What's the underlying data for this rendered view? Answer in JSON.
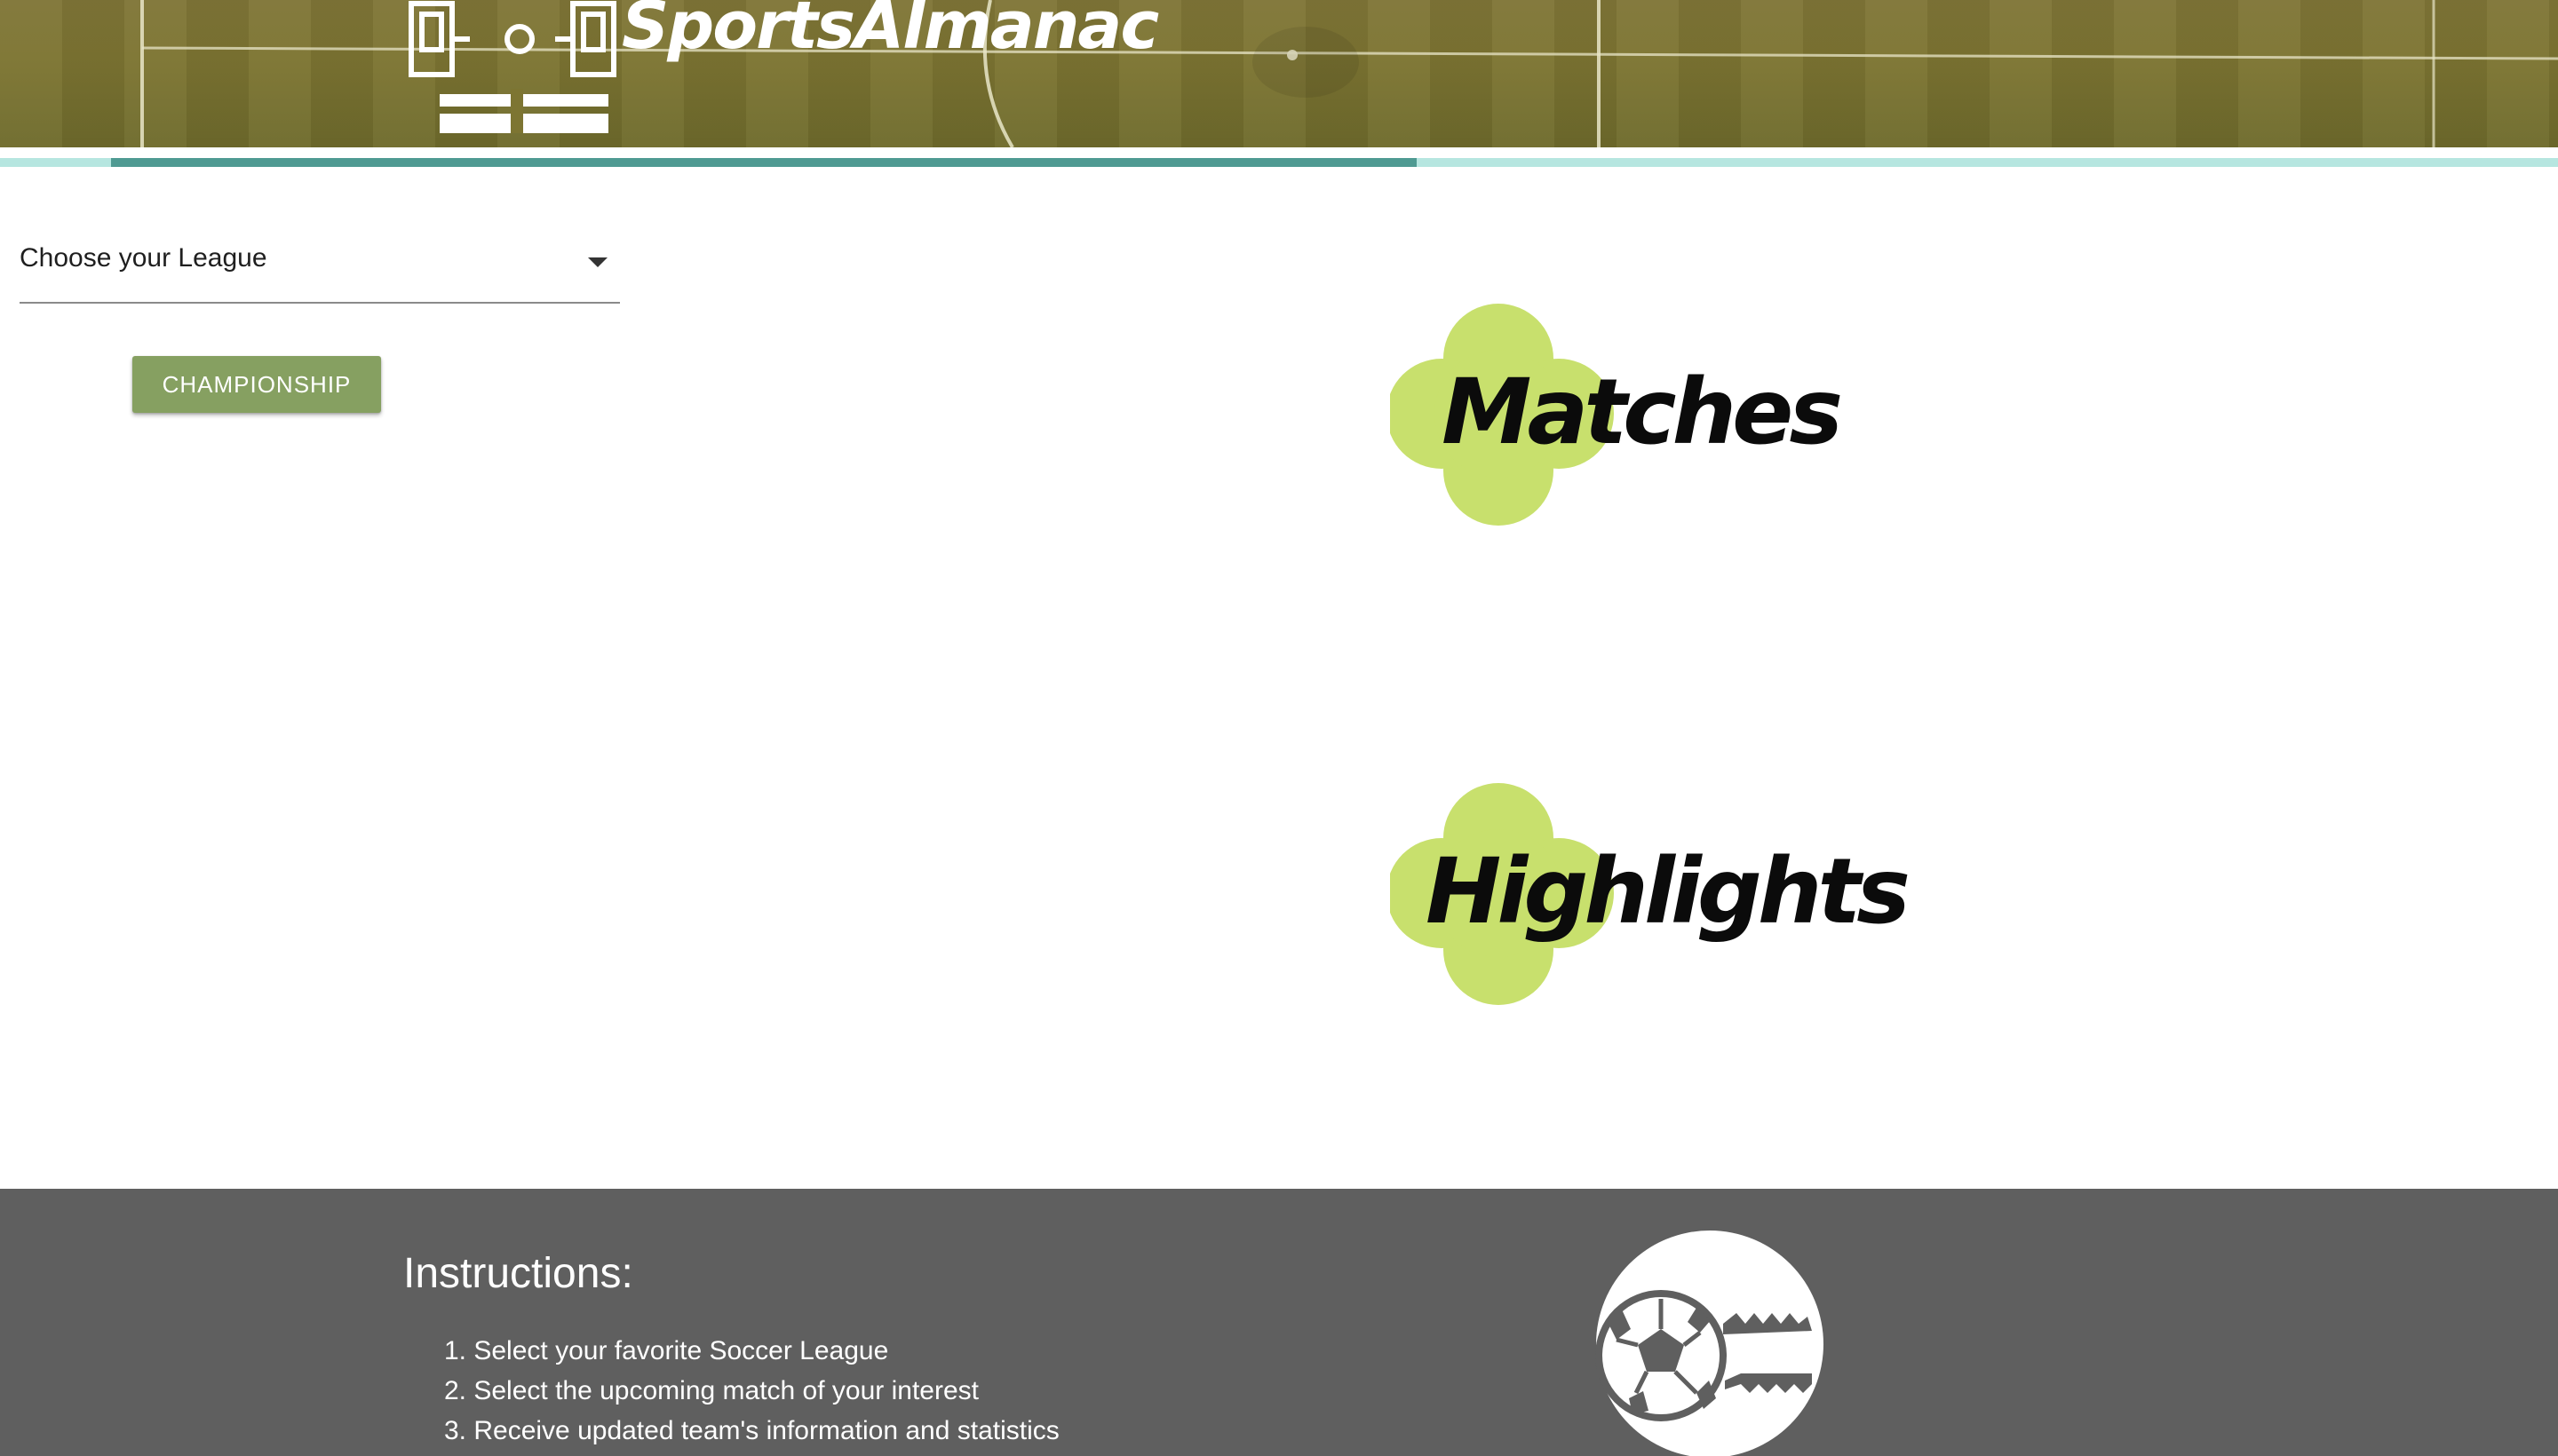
{
  "header": {
    "brand_name": "SportsAlmanac",
    "logo_icon": "stadium-logo-icon"
  },
  "progress": {
    "filled_fraction": 0.51
  },
  "league_select": {
    "label": "Choose your League",
    "icon": "chevron-down-icon"
  },
  "league_button": {
    "label": "CHAMPIONSHIP"
  },
  "nav": {
    "matches_label": "Matches",
    "highlights_label": "Highlights",
    "accent_color": "#c8e06d"
  },
  "footer": {
    "title": "Instructions:",
    "steps": [
      "1. Select your favorite Soccer League",
      "2. Select the upcoming match of your interest",
      "3. Receive updated team's information and statistics"
    ],
    "logo_icon": "soccer-ball-cleat-icon"
  },
  "colors": {
    "header_green": "#7d7532",
    "progress_track": "#b6e6e0",
    "progress_fill": "#4f9a92",
    "button_green": "#86a061",
    "footer_gray": "#5f5f5f"
  }
}
